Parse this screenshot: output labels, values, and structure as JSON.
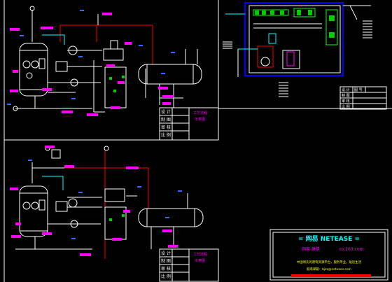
{
  "title_blocks": {
    "top": {
      "rows": [
        "设 计",
        "制 图",
        "审 核",
        "比 例"
      ],
      "mag1": "工艺流程",
      "mag2": "示意图"
    },
    "bottom": {
      "rows": [
        "设 计",
        "制 图",
        "审 核",
        "比 例"
      ],
      "mag1": "工艺流程",
      "mag2": "示意图"
    },
    "right_table": {
      "rows": [
        "设 计",
        "制 图",
        "审 核",
        "比 例"
      ],
      "extra": "图 号"
    }
  },
  "banner": {
    "title": "= 网易 NETEASE =",
    "subtitle_left": "网易·建筑",
    "subtitle_right": "co.163.com",
    "line1": "中国领先的建筑资源平台，服务专业，贴近生活",
    "line2": "联系邮箱：bjzx@netease.com"
  },
  "tags": {
    "t1": "FGD0001",
    "t2": "PG0001",
    "t3": "PG0002",
    "t4": "FG0001",
    "t5": "FG0002",
    "t6": "FG0003",
    "t7": "FG0004",
    "t8": "FG0005"
  },
  "colors": {
    "bg": "#000000",
    "line": "#ffffff",
    "magenta": "#ff00ff",
    "blue": "#0000ff",
    "cyan": "#00ffff",
    "red": "#ff0000",
    "green": "#00ff00",
    "yellow": "#ffff00"
  }
}
